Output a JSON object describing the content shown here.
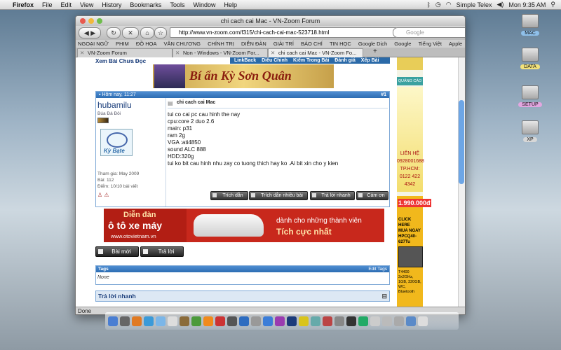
{
  "menubar": {
    "apple": "",
    "app": "Firefox",
    "items": [
      "File",
      "Edit",
      "View",
      "History",
      "Bookmarks",
      "Tools",
      "Window",
      "Help"
    ],
    "input_source": "Simple Telex",
    "clock": "Mon 9:35 AM"
  },
  "desktop": {
    "drives": [
      {
        "label": "MAC",
        "color": "#8fc0ea"
      },
      {
        "label": "DATA",
        "color": "#f3e27a"
      },
      {
        "label": "SETUP",
        "color": "#e3a6e0"
      },
      {
        "label": "XP",
        "color": "#d7d7d7"
      }
    ]
  },
  "browser": {
    "title": "chi cach cai Mac - VN-Zoom Forum",
    "url": "http://www.vn-zoom.com/f315/chi-cach-cai-mac-523718.html",
    "search_placeholder": "Google",
    "bookmarks": [
      "NGOẠI NGỮ",
      "PHIM",
      "ĐỒ HỌA",
      "VĂN CHƯƠNG",
      "CHÍNH TRỊ",
      "DIỄN ĐÀN",
      "GIẢI TRÍ",
      "BÁO CHÍ",
      "TIN HỌC",
      "Google Dịch",
      "Google",
      "Tiếng Việt",
      "Apple"
    ],
    "tabs": [
      "VN-Zoom Forum",
      "Non - Windows - VN-Zoom For...",
      "chi cach cai Mac - VN-Zoom Fo..."
    ],
    "new_tab": "+",
    "status": "Done"
  },
  "page": {
    "unread_link": "Xem Bài Chưa Đọc",
    "pagebar": [
      "LinkBack",
      "Diễu Chỉnh",
      "Kiếm Trong Bài",
      "Đánh giá",
      "Xếp Bài"
    ],
    "top_banner_text": "Bí ẩn Kỳ Sơn Quân",
    "post": {
      "timestamp": "Hôm nay, 11:27",
      "number": "#1",
      "username": "hubamilu",
      "user_title": "Búa Đá Đôi",
      "avatar_text": "Kỳ Bạte",
      "joined": "Tham gia: May 2009",
      "posts": "Bài: 112",
      "points": "Điểm: 10/10 bài viết",
      "title": "chi cach cai Mac",
      "lines": [
        "tui co cai pc cau hinh the nay",
        "cpu:core 2 duo 2.6",
        "main: p31",
        "ram 2g",
        "VGA :ati4850",
        "sound ALC 888",
        "HDD:320g",
        "tui ko bit cau hinh nhu zay co tuong thich hay ko .Ai bit xin cho y kien"
      ],
      "buttons": [
        "Trích dẫn",
        "Trích dẫn nhiều bài",
        "Trả lời nhanh",
        "Cảm ơn"
      ]
    },
    "mid_banner": {
      "line1": "Diễn đàn",
      "line2": "ô tô xe máy",
      "site": "www.otovietnam.vn",
      "line3": "dành cho những thành viên",
      "line4": "Tích cực nhất"
    },
    "actions": [
      "Bài mới",
      "Trả lời"
    ],
    "tags": {
      "header": "Tags",
      "edit": "Edit Tags",
      "body": "None"
    },
    "quick_reply": "Trả lời nhanh",
    "right_ads": {
      "ad_label": "QUẢNG CÁO",
      "contact": [
        "LIÊN HỆ",
        "0928001688",
        "TP.HCM:",
        "0122 422 4342"
      ],
      "price": "1.990.000đ",
      "promo": [
        "CLICK HERE",
        "MUA NGAY",
        "HPCQ40-627Tu"
      ],
      "specs": [
        "T4400 2x2GHz,",
        "1GB, 320GB,",
        "WC, Bluetooth"
      ]
    }
  }
}
